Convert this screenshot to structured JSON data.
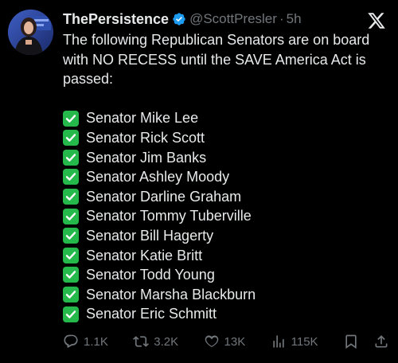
{
  "author": {
    "display_name": "ThePersistence",
    "handle": "@ScottPresler",
    "separator": "·",
    "time": "5h",
    "verified": true
  },
  "tweet": {
    "intro": "The following Republican Senators are on board with NO RECESS until the SAVE America Act is passed:",
    "senators": [
      "Senator Mike Lee",
      "Senator Rick Scott",
      "Senator Jim Banks",
      "Senator Ashley Moody",
      "Senator Darline Graham",
      "Senator Tommy Tuberville",
      "Senator Bill Hagerty",
      "Senator Katie Britt",
      "Senator Todd Young",
      "Senator Marsha Blackburn",
      "Senator Eric Schmitt"
    ],
    "list_icon": "check-mark-button-emoji"
  },
  "actions": {
    "replies": "1.1K",
    "reposts": "3.2K",
    "likes": "13K",
    "views": "115K"
  },
  "colors": {
    "background": "#000000",
    "text": "#e7e9ea",
    "muted": "#71767b",
    "verified": "#1d9bf0",
    "check": "#25b84a"
  }
}
